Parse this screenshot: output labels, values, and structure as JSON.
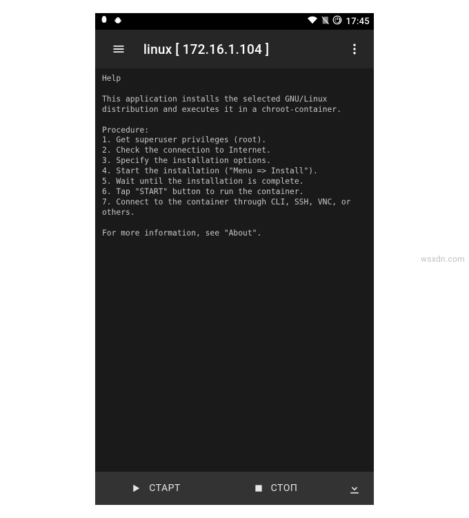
{
  "statusbar": {
    "time": "17:45"
  },
  "toolbar": {
    "title": "linux  [ 172.16.1.104 ]"
  },
  "help": {
    "heading": "Help",
    "intro": "This application installs the selected GNU/Linux\ndistribution and executes it in a chroot-container.",
    "procedure_label": "Procedure:",
    "steps": [
      "1. Get superuser privileges (root).",
      "2. Check the connection to Internet.",
      "3. Specify the installation options.",
      "4. Start the installation (\"Menu => Install\").",
      "5. Wait until the installation is complete.",
      "6. Tap \"START\" button to run the container.",
      "7. Connect to the container through CLI, SSH, VNC, or\nothers."
    ],
    "footer": "For more information, see \"About\"."
  },
  "bottombar": {
    "start_label": "СТАРТ",
    "stop_label": "СТОП"
  },
  "watermark": "wsxdn.com"
}
